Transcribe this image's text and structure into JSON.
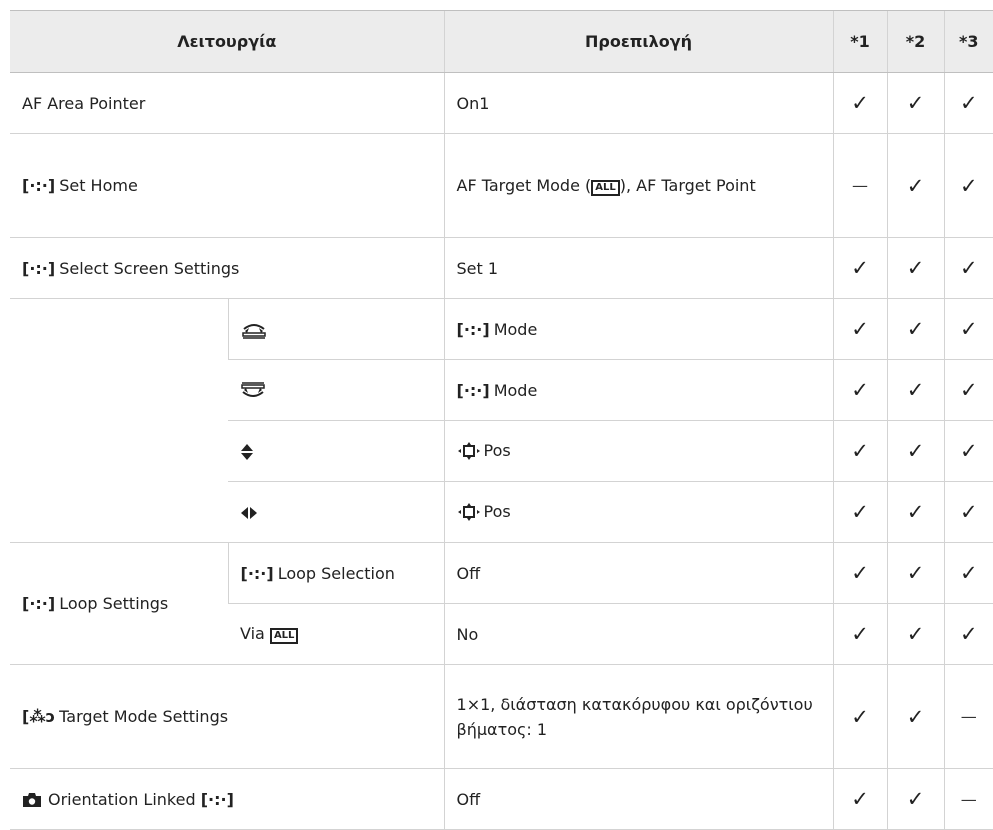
{
  "header": {
    "function": "Λειτουργία",
    "default": "Προεπιλογή",
    "c1": "*1",
    "c2": "*2",
    "c3": "*3"
  },
  "marks": {
    "check": "✓",
    "dash": "—"
  },
  "symbols": {
    "af_area": "[·:·]",
    "all_targets": "ALL",
    "group_target": "[⁂ↄ"
  },
  "rows": {
    "r1": {
      "name": "AF Area Pointer",
      "default": "On1",
      "c1": "check",
      "c2": "check",
      "c3": "check"
    },
    "r2": {
      "name": "Set Home",
      "default_pre": "AF Target Mode (",
      "default_post": "), AF Target Point",
      "c1": "dash",
      "c2": "check",
      "c3": "check"
    },
    "r3": {
      "name": "Select Screen Settings",
      "default": "Set 1",
      "c1": "check",
      "c2": "check",
      "c3": "check"
    },
    "r4": {
      "icon": "front-dial-icon",
      "default": "Mode",
      "c1": "check",
      "c2": "check",
      "c3": "check"
    },
    "r5": {
      "icon": "rear-dial-icon",
      "default": "Mode",
      "c1": "check",
      "c2": "check",
      "c3": "check"
    },
    "r6": {
      "icon": "up-down-arrows-icon",
      "default": "Pos",
      "c1": "check",
      "c2": "check",
      "c3": "check"
    },
    "r7": {
      "icon": "left-right-arrows-icon",
      "default": "Pos",
      "c1": "check",
      "c2": "check",
      "c3": "check"
    },
    "r8": {
      "group": "Loop Settings",
      "sub": "Loop Selection",
      "default": "Off",
      "c1": "check",
      "c2": "check",
      "c3": "check"
    },
    "r9": {
      "sub": "Via",
      "default": "No",
      "c1": "check",
      "c2": "check",
      "c3": "check"
    },
    "r10": {
      "name": "Target Mode Settings",
      "default": "1×1, διάσταση κατακόρυφου και οριζόντιου βήματος: 1",
      "c1": "check",
      "c2": "check",
      "c3": "dash"
    },
    "r11": {
      "name": "Orientation Linked",
      "default": "Off",
      "c1": "check",
      "c2": "check",
      "c3": "dash"
    }
  }
}
